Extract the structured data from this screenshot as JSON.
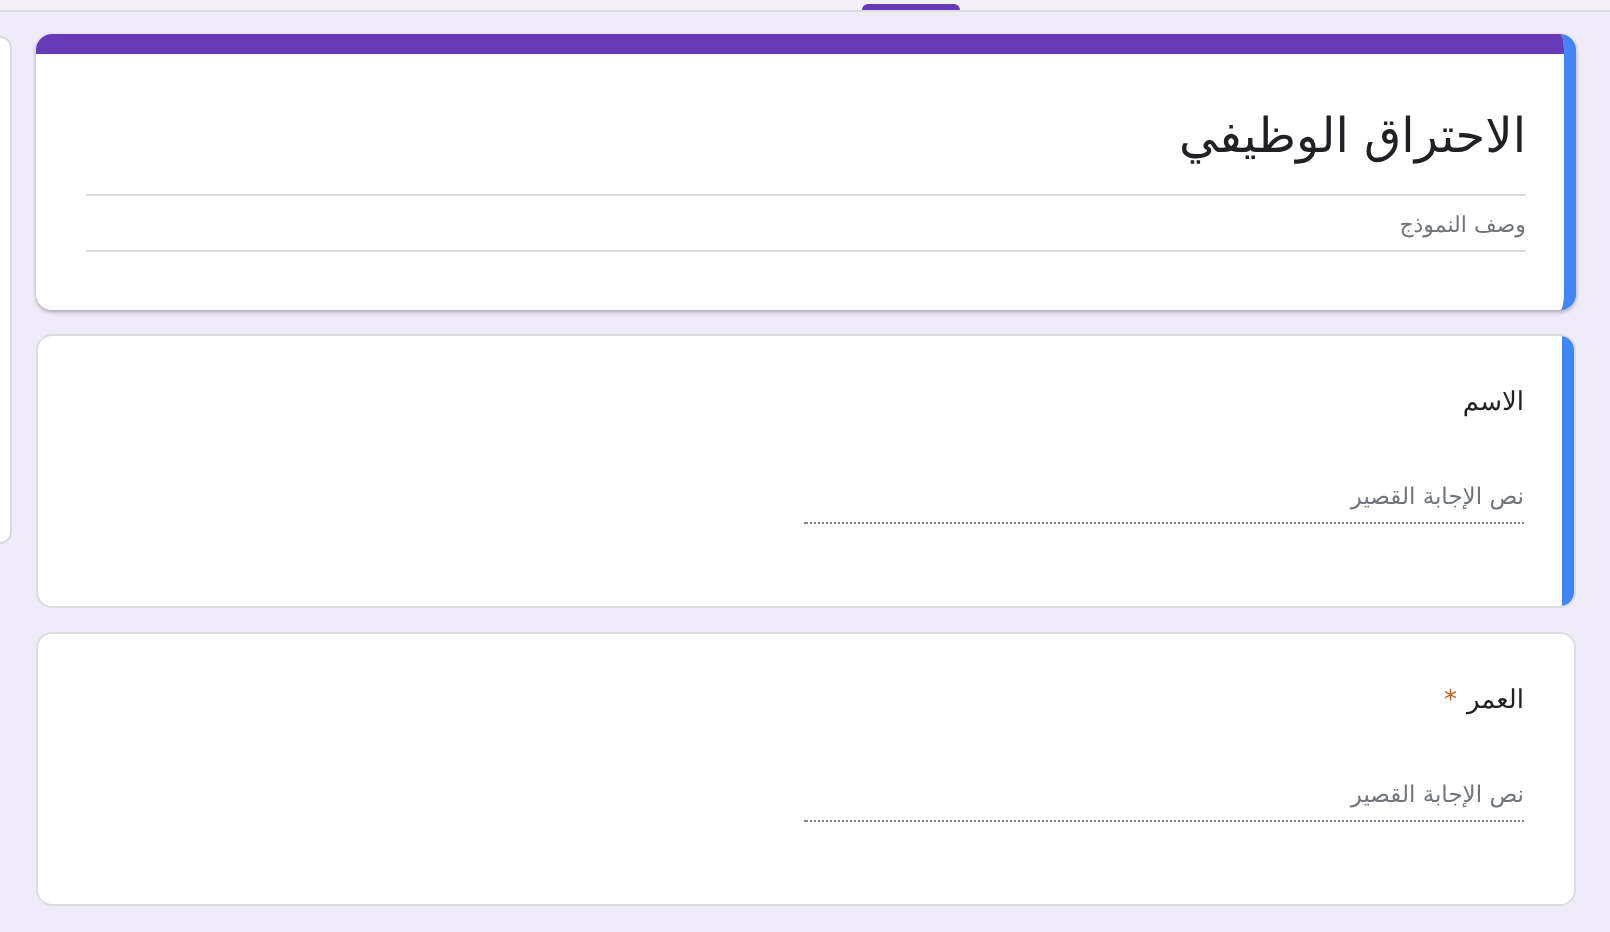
{
  "form": {
    "title": "الاحتراق الوظيفي",
    "description_placeholder": "وصف النموذج",
    "selected": true
  },
  "required_marker": "*",
  "questions": [
    {
      "title": "الاسم",
      "required": false,
      "selected": true,
      "answer_placeholder": "نص الإجابة القصير"
    },
    {
      "title": "العمر",
      "required": true,
      "selected": false,
      "answer_placeholder": "نص الإجابة القصير"
    }
  ]
}
